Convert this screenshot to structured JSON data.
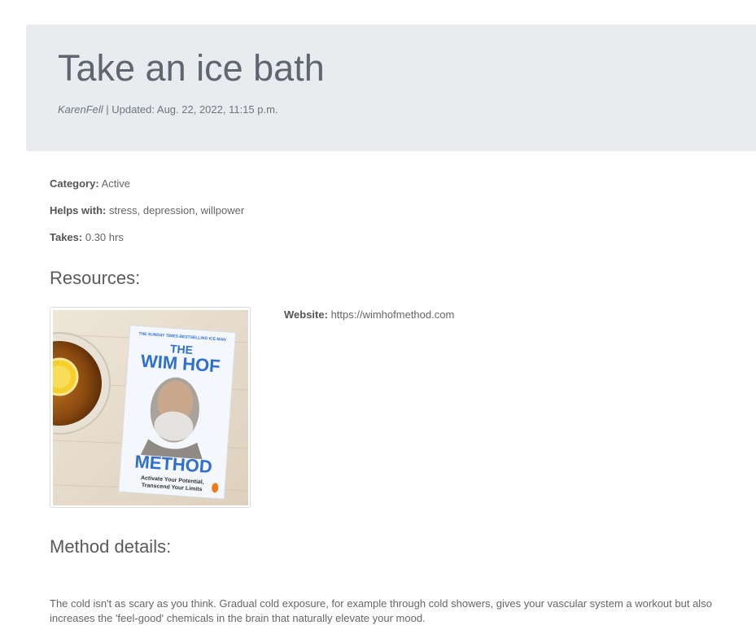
{
  "header": {
    "title": "Take an ice bath",
    "author": "KarenFell",
    "updated": " | Updated: Aug. 22, 2022, 11:15 p.m."
  },
  "details": {
    "category_label": "Category:",
    "category_value": "Active",
    "helps_label": "Helps with:",
    "helps_value": "stress, depression, willpower",
    "takes_label": "Takes:",
    "takes_value": "0.30 hrs"
  },
  "resources": {
    "heading": "Resources:",
    "book": {
      "tagline": "THE SUNDAY TIMES BESTSELLING ICE MAN",
      "the": "THE",
      "title": "WIM HOF",
      "subtitle": "METHOD",
      "blurb_line1": "Activate Your Potential,",
      "blurb_line2": "Transcend Your Limits"
    },
    "website_label": "Website:",
    "website_value": "https://wimhofmethod.com"
  },
  "method": {
    "heading": "Method details:",
    "body": "The cold isn't as scary as you think. Gradual cold exposure, for example through cold showers, gives your vascular system a workout but also increases the 'feel-good' chemicals in the brain that naturally elevate your mood."
  }
}
